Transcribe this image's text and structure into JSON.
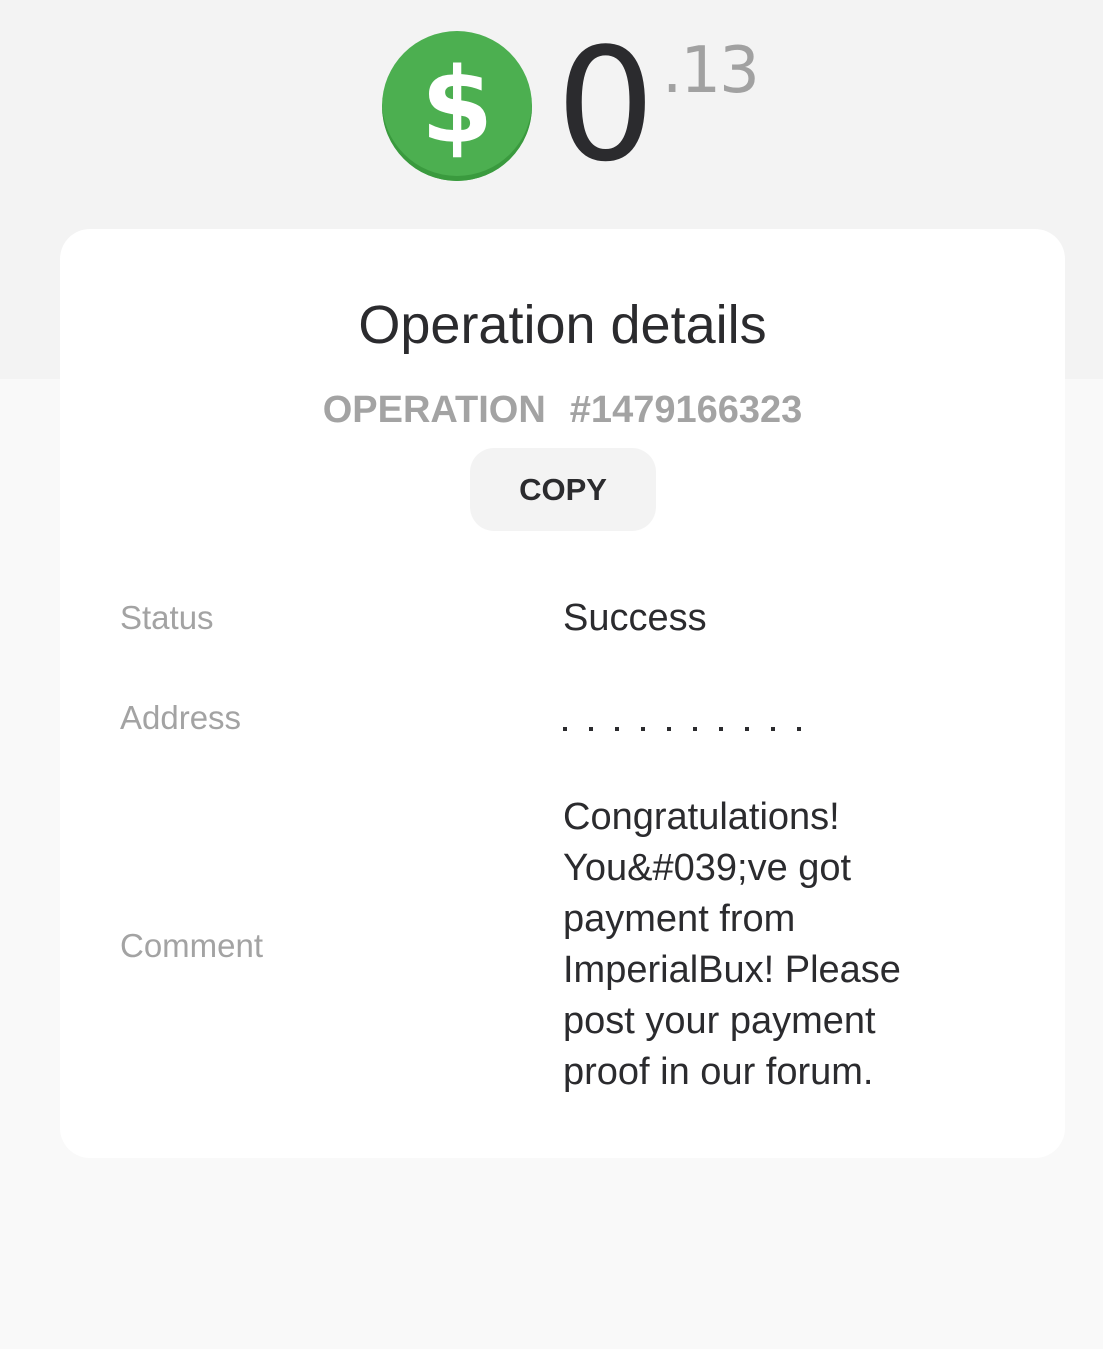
{
  "balance": {
    "currency_symbol": "$",
    "currency_icon": "dollar-coin-icon",
    "amount_integer": "0",
    "amount_fraction": ".13",
    "coin_color": "#4caf50"
  },
  "details": {
    "title": "Operation details",
    "operation_label": "OPERATION",
    "operation_number": "#1479166323",
    "copy_label": "COPY",
    "rows": {
      "status": {
        "label": "Status",
        "value": "Success"
      },
      "address": {
        "label": "Address",
        "value": ""
      },
      "comment": {
        "label": "Comment",
        "lines": [
          "Congratulations!",
          "You&#039;ve got",
          "payment from",
          "ImperialBux! Please",
          "post your payment",
          "proof in our forum."
        ]
      }
    }
  }
}
